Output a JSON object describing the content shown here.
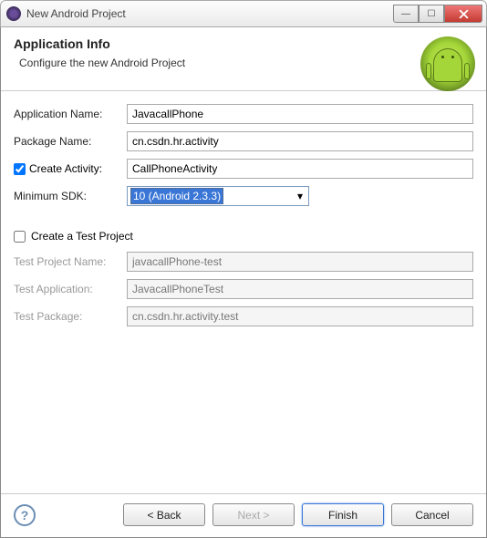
{
  "window": {
    "title": "New Android Project"
  },
  "header": {
    "title": "Application Info",
    "subtitle": "Configure the new Android Project"
  },
  "labels": {
    "appName": "Application Name:",
    "packageName": "Package Name:",
    "createActivity": "Create Activity:",
    "minSdk": "Minimum SDK:",
    "createTestProject": "Create a Test Project",
    "testProjectName": "Test Project Name:",
    "testApplication": "Test Application:",
    "testPackage": "Test Package:"
  },
  "values": {
    "appName": "JavacallPhone",
    "packageName": "cn.csdn.hr.activity",
    "activityName": "CallPhoneActivity",
    "minSdk": "10 (Android 2.3.3)",
    "testProjectName": "javacallPhone-test",
    "testApplication": "JavacallPhoneTest",
    "testPackage": "cn.csdn.hr.activity.test"
  },
  "buttons": {
    "back": "< Back",
    "next": "Next >",
    "finish": "Finish",
    "cancel": "Cancel",
    "help": "?"
  }
}
